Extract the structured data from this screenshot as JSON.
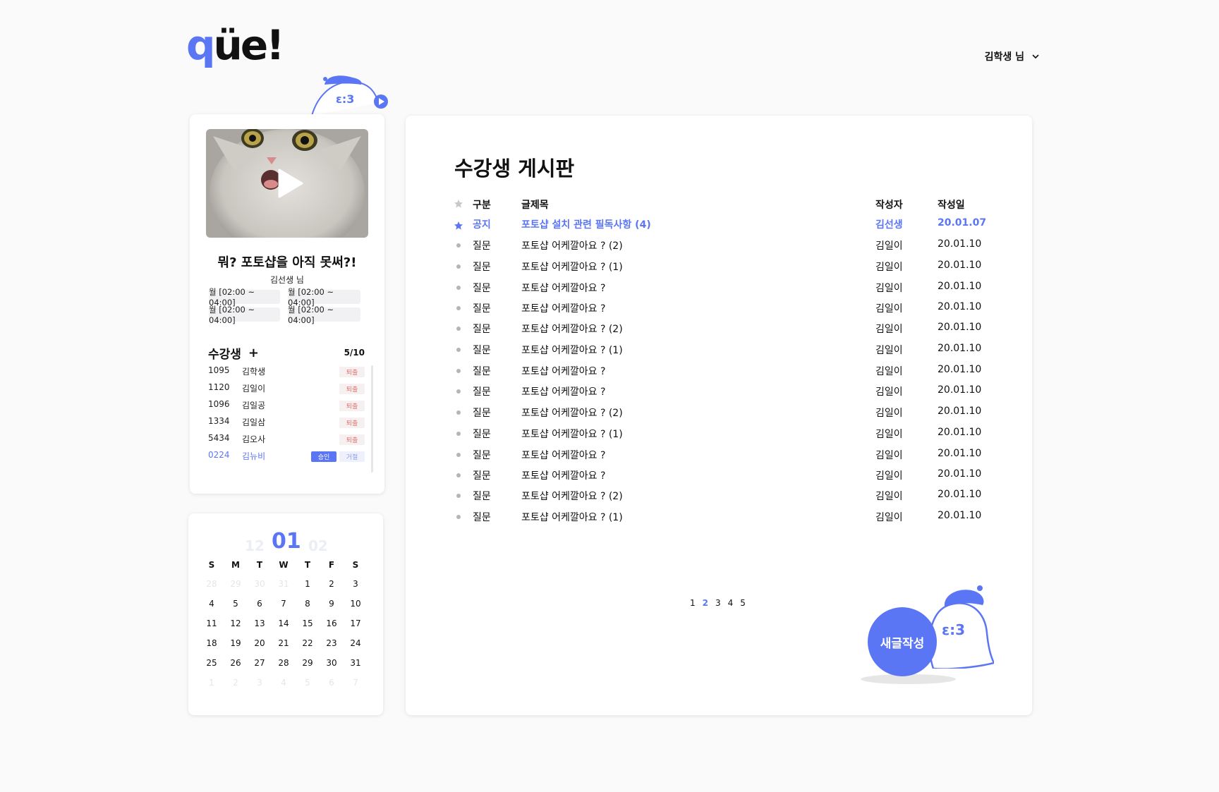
{
  "header": {
    "logo_q": "q",
    "logo_rest": "üe!",
    "user_label": "김학생 님"
  },
  "colors": {
    "accent": "#5b76f4",
    "reject": "#e07676",
    "bg": "#fafafa"
  },
  "course": {
    "title": "뭐? 포토샵을 아직 못써?!",
    "teacher": "김선생 님",
    "schedule": [
      "월  [02:00 ~ 04:00]",
      "월  [02:00 ~ 04:00]",
      "월  [02:00 ~ 04:00]",
      "월  [02:00 ~ 04:00]"
    ]
  },
  "students": {
    "title": "수강생",
    "add_label": "+",
    "count": "5/10",
    "list": [
      {
        "id": "1095",
        "name": "김학생",
        "action": "퇴출"
      },
      {
        "id": "1120",
        "name": "김일이",
        "action": "퇴출"
      },
      {
        "id": "1096",
        "name": "김일공",
        "action": "퇴출"
      },
      {
        "id": "1334",
        "name": "김일삼",
        "action": "퇴출"
      },
      {
        "id": "5434",
        "name": "김오사",
        "action": "퇴출"
      }
    ],
    "pending": {
      "id": "0224",
      "name": "김뉴비",
      "approve": "승인",
      "reject": "거절"
    }
  },
  "calendar": {
    "prev_month": "12",
    "current_month": "01",
    "next_month": "02",
    "weekdays": [
      "S",
      "M",
      "T",
      "W",
      "T",
      "F",
      "S"
    ],
    "days": [
      [
        "28",
        "m"
      ],
      [
        "29",
        "m"
      ],
      [
        "30",
        "m"
      ],
      [
        "31",
        "m"
      ],
      [
        "1",
        ""
      ],
      [
        "2",
        ""
      ],
      [
        "3",
        ""
      ],
      [
        "4",
        ""
      ],
      [
        "5",
        ""
      ],
      [
        "6",
        ""
      ],
      [
        "7",
        ""
      ],
      [
        "8",
        ""
      ],
      [
        "9",
        ""
      ],
      [
        "10",
        ""
      ],
      [
        "11",
        ""
      ],
      [
        "12",
        ""
      ],
      [
        "13",
        ""
      ],
      [
        "14",
        ""
      ],
      [
        "15",
        ""
      ],
      [
        "16",
        ""
      ],
      [
        "17",
        ""
      ],
      [
        "18",
        ""
      ],
      [
        "19",
        ""
      ],
      [
        "20",
        ""
      ],
      [
        "21",
        ""
      ],
      [
        "22",
        ""
      ],
      [
        "23",
        ""
      ],
      [
        "24",
        ""
      ],
      [
        "25",
        ""
      ],
      [
        "26",
        ""
      ],
      [
        "27",
        ""
      ],
      [
        "28",
        ""
      ],
      [
        "29",
        ""
      ],
      [
        "30",
        ""
      ],
      [
        "31",
        ""
      ],
      [
        "1",
        "m"
      ],
      [
        "2",
        "m"
      ],
      [
        "3",
        "m"
      ],
      [
        "4",
        "m"
      ],
      [
        "5",
        "m"
      ],
      [
        "6",
        "m"
      ],
      [
        "7",
        "m"
      ]
    ]
  },
  "board": {
    "title": "수강생 게시판",
    "headers": {
      "category": "구분",
      "title": "글제목",
      "author": "작성자",
      "date": "작성일"
    },
    "posts": [
      {
        "category": "공지",
        "title": "포토샵 설치 관련 필독사항 (4)",
        "author": "김선생",
        "date": "20.01.07",
        "notice": true
      },
      {
        "category": "질문",
        "title": "포토샵 어케깔아요 ? (2)",
        "author": "김일이",
        "date": "20.01.10"
      },
      {
        "category": "질문",
        "title": "포토샵 어케깔아요 ? (1)",
        "author": "김일이",
        "date": "20.01.10"
      },
      {
        "category": "질문",
        "title": "포토샵 어케깔아요 ?",
        "author": "김일이",
        "date": "20.01.10"
      },
      {
        "category": "질문",
        "title": "포토샵 어케깔아요 ?",
        "author": "김일이",
        "date": "20.01.10"
      },
      {
        "category": "질문",
        "title": "포토샵 어케깔아요 ? (2)",
        "author": "김일이",
        "date": "20.01.10"
      },
      {
        "category": "질문",
        "title": "포토샵 어케깔아요 ? (1)",
        "author": "김일이",
        "date": "20.01.10"
      },
      {
        "category": "질문",
        "title": "포토샵 어케깔아요 ?",
        "author": "김일이",
        "date": "20.01.10"
      },
      {
        "category": "질문",
        "title": "포토샵 어케깔아요 ?",
        "author": "김일이",
        "date": "20.01.10"
      },
      {
        "category": "질문",
        "title": "포토샵 어케깔아요 ? (2)",
        "author": "김일이",
        "date": "20.01.10"
      },
      {
        "category": "질문",
        "title": "포토샵 어케깔아요 ? (1)",
        "author": "김일이",
        "date": "20.01.10"
      },
      {
        "category": "질문",
        "title": "포토샵 어케깔아요 ?",
        "author": "김일이",
        "date": "20.01.10"
      },
      {
        "category": "질문",
        "title": "포토샵 어케깔아요 ?",
        "author": "김일이",
        "date": "20.01.10"
      },
      {
        "category": "질문",
        "title": "포토샵 어케깔아요 ? (2)",
        "author": "김일이",
        "date": "20.01.10"
      },
      {
        "category": "질문",
        "title": "포토샵 어케깔아요 ? (1)",
        "author": "김일이",
        "date": "20.01.10"
      }
    ],
    "pages": [
      "1",
      "2",
      "3",
      "4",
      "5"
    ],
    "current_page": "2",
    "write_label": "새글작성"
  }
}
